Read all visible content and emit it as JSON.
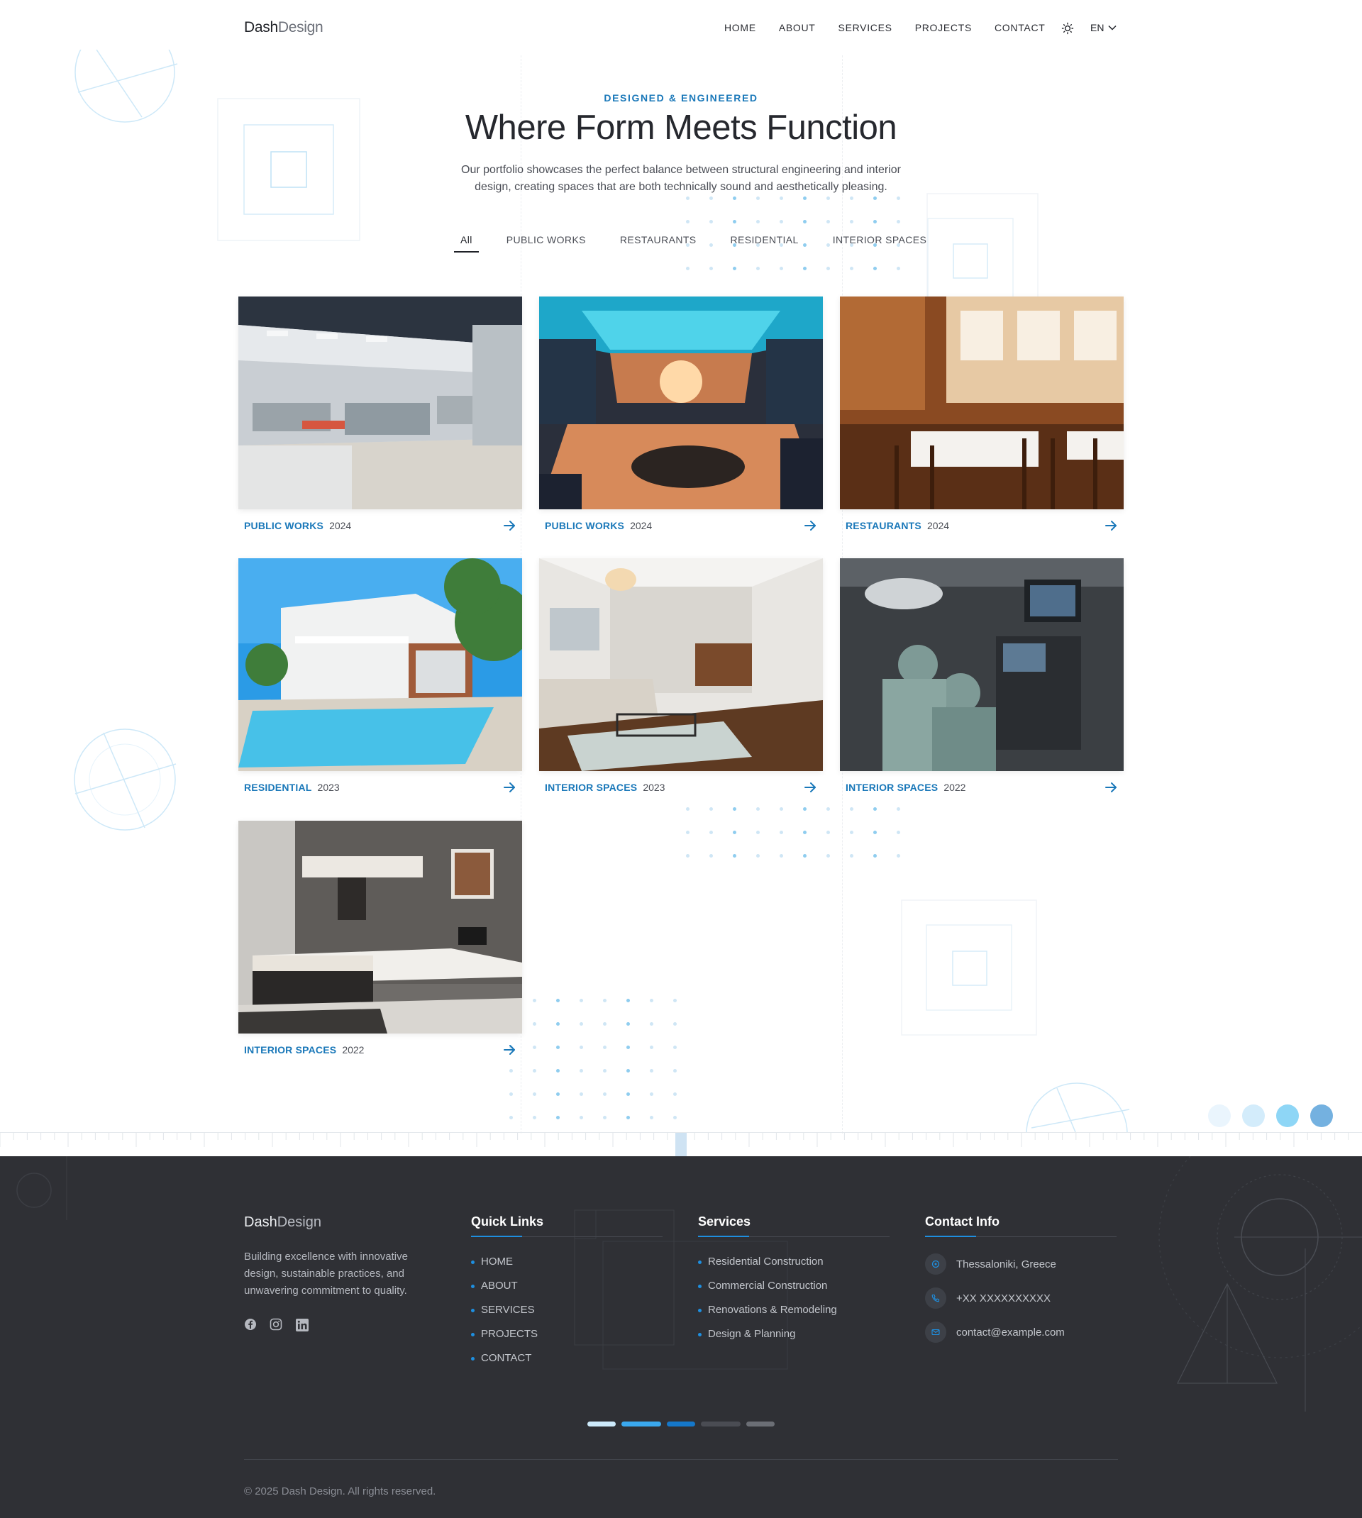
{
  "header": {
    "logo_bold": "Dash",
    "logo_light": "Design",
    "nav": [
      "HOME",
      "ABOUT",
      "SERVICES",
      "PROJECTS",
      "CONTACT"
    ],
    "theme_icon": "sun-icon",
    "language": "EN"
  },
  "hero": {
    "eyebrow": "DESIGNED & ENGINEERED",
    "title": "Where Form Meets Function",
    "subtitle_line1": "Our portfolio showcases the perfect balance between structural engineering and interior",
    "subtitle_line2": "design, creating spaces that are both technically sound and aesthetically pleasing."
  },
  "filters": {
    "items": [
      "All",
      "PUBLIC WORKS",
      "RESTAURANTS",
      "RESIDENTIAL",
      "INTERIOR SPACES"
    ],
    "active": "All"
  },
  "projects": [
    {
      "category": "PUBLIC WORKS",
      "year": "2024",
      "image": "open-plan office interior"
    },
    {
      "category": "PUBLIC WORKS",
      "year": "2024",
      "image": "shopping mall atrium"
    },
    {
      "category": "RESTAURANTS",
      "year": "2024",
      "image": "restaurant dining room"
    },
    {
      "category": "RESIDENTIAL",
      "year": "2023",
      "image": "house with pool"
    },
    {
      "category": "INTERIOR SPACES",
      "year": "2023",
      "image": "living room interior"
    },
    {
      "category": "INTERIOR SPACES",
      "year": "2022",
      "image": "hospital operating room"
    },
    {
      "category": "INTERIOR SPACES",
      "year": "2022",
      "image": "bedroom with desk"
    }
  ],
  "footer": {
    "logo_bold": "Dash",
    "logo_light": "Design",
    "about_line1": "Building excellence with innovative",
    "about_line2": "design, sustainable practices, and",
    "about_line3": "unwavering commitment to quality.",
    "social": [
      "facebook-icon",
      "instagram-icon",
      "linkedin-icon"
    ],
    "quick_links": {
      "title": "Quick Links",
      "items": [
        "HOME",
        "ABOUT",
        "SERVICES",
        "PROJECTS",
        "CONTACT"
      ]
    },
    "services": {
      "title": "Services",
      "items": [
        "Residential Construction",
        "Commercial Construction",
        "Renovations & Remodeling",
        "Design & Planning"
      ]
    },
    "contact": {
      "title": "Contact Info",
      "location": "Thessaloniki, Greece",
      "phone": "+XX XXXXXXXXXX",
      "email": "contact@example.com"
    },
    "copyright": "© 2025 Dash Design. All rights reserved."
  },
  "colors": {
    "accent": "#1a78b9",
    "accent_bright": "#1e8fe0",
    "footer_bg": "#2f3035",
    "circle_1": "#eaf5fd",
    "circle_2": "#d3ecfb",
    "circle_3": "#8ed6f6",
    "circle_4": "#74b1e0"
  }
}
